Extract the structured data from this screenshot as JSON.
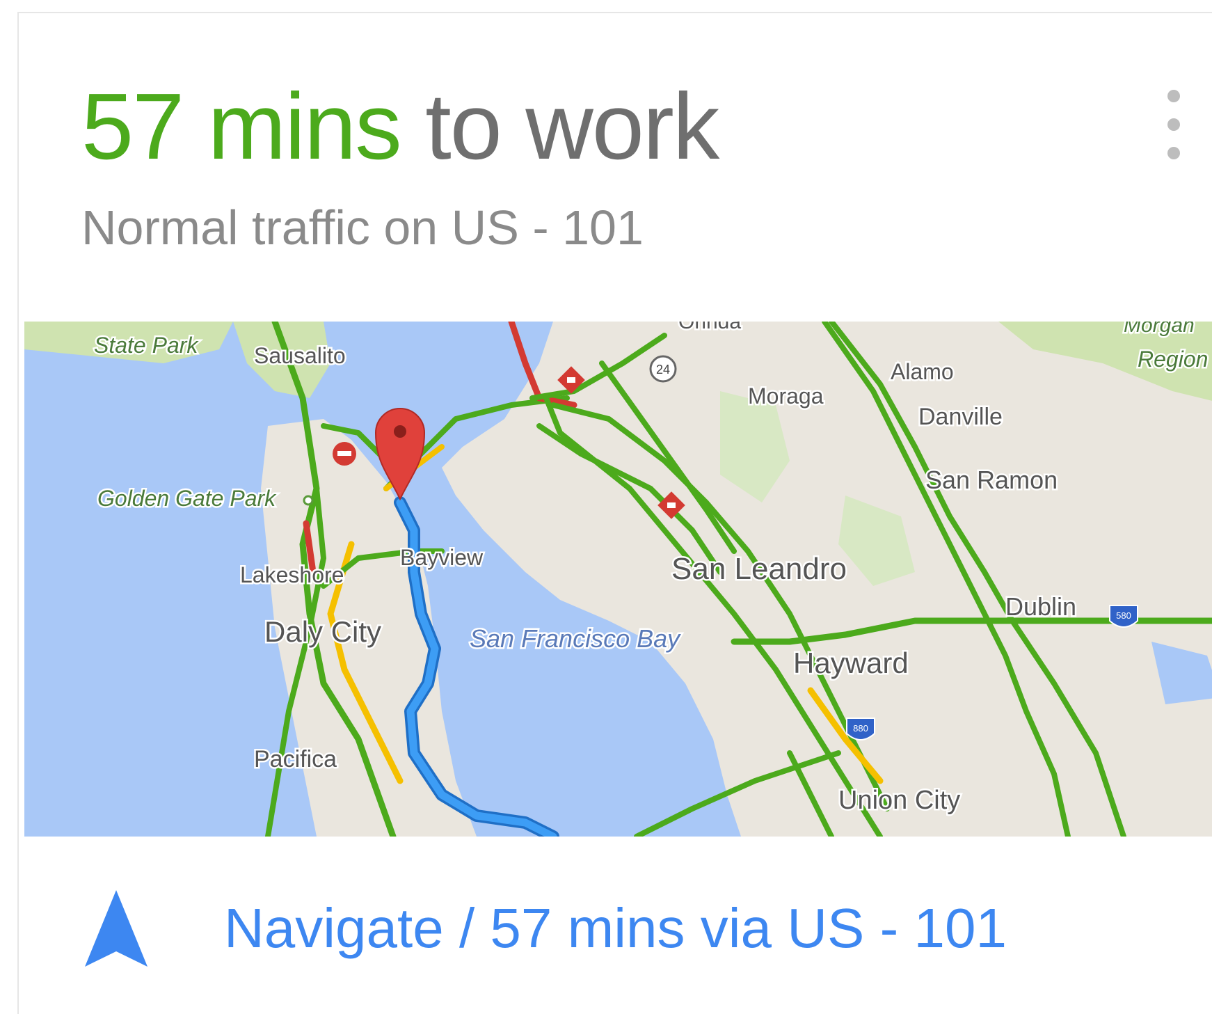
{
  "card": {
    "title_duration": "57 mins",
    "title_rest": "to work",
    "subtitle": "Normal traffic on US - 101",
    "menu_icon": "more-vert-icon"
  },
  "map": {
    "labels": {
      "state_park": "State Park",
      "sausalito": "Sausalito",
      "orinda": "Orinda",
      "morgan": "Morgan",
      "regional": "Region",
      "moraga": "Moraga",
      "alamo": "Alamo",
      "danville": "Danville",
      "san_ramon": "San Ramon",
      "golden_gate_park": "Golden Gate Park",
      "bayview": "Bayview",
      "lakeshore": "Lakeshore",
      "san_leandro": "San Leandro",
      "daly_city": "Daly City",
      "sf_bay": "San Francisco Bay",
      "dublin": "Dublin",
      "hayward": "Hayward",
      "pacifica": "Pacifica",
      "union_city": "Union City",
      "hwy_24": "24",
      "hwy_580": "580",
      "hwy_880": "880"
    },
    "colors": {
      "water": "#a9c8f7",
      "land": "#eae6de",
      "park": "#cfe3b0",
      "traffic_normal": "#4caa1c",
      "traffic_slow": "#f5c000",
      "traffic_heavy": "#d33a32",
      "route": "#3d9df5",
      "pin": "#e0413b"
    }
  },
  "navigate": {
    "icon": "navigation-arrow-icon",
    "label": "Navigate / 57 mins via US - 101"
  }
}
